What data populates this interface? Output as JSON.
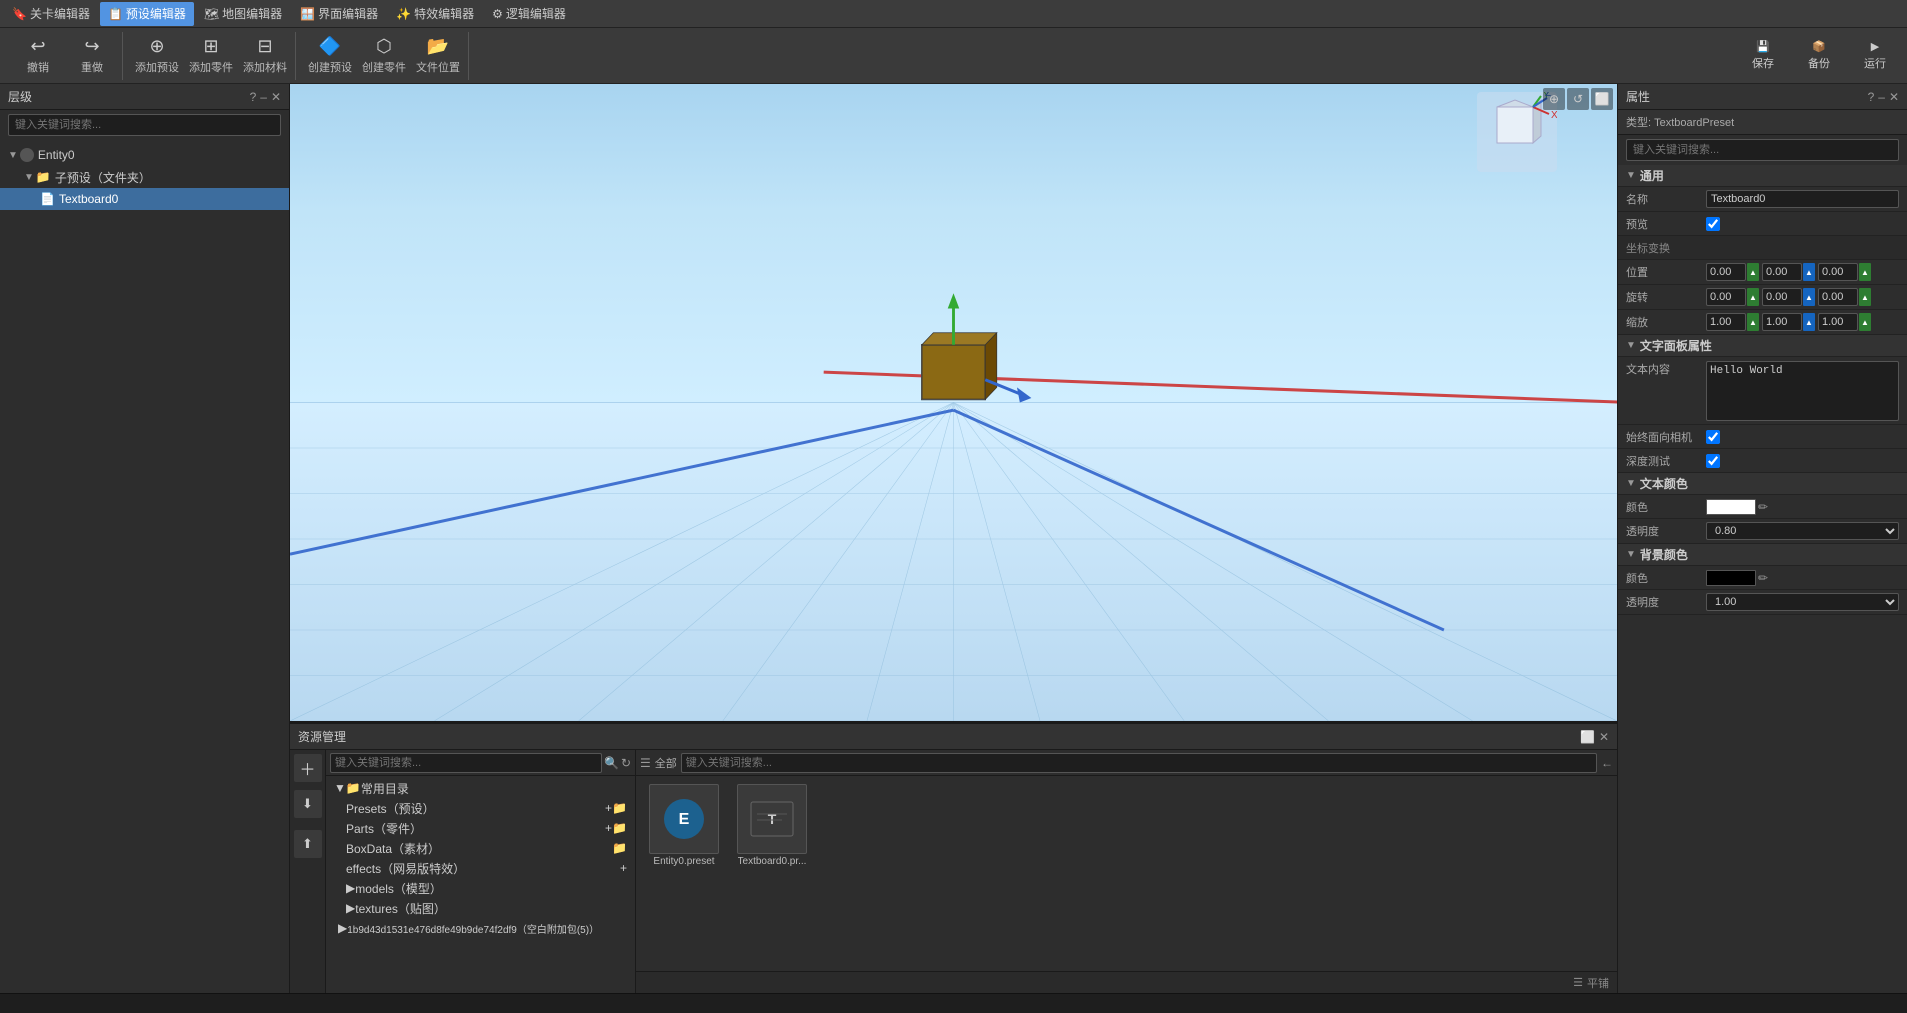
{
  "app": {
    "title": "预设编辑器"
  },
  "menu_tabs": [
    {
      "id": "bookmark",
      "label": "关卡编辑器",
      "icon": "🔖",
      "active": false
    },
    {
      "id": "preset",
      "label": "预设编辑器",
      "icon": "📋",
      "active": true
    },
    {
      "id": "map",
      "label": "地图编辑器",
      "icon": "🗺",
      "active": false
    },
    {
      "id": "ui",
      "label": "界面编辑器",
      "icon": "🪟",
      "active": false
    },
    {
      "id": "effect",
      "label": "特效编辑器",
      "icon": "✨",
      "active": false
    },
    {
      "id": "logic",
      "label": "逻辑编辑器",
      "icon": "⚙",
      "active": false
    }
  ],
  "toolbar": {
    "undo_label": "撤销",
    "redo_label": "重做",
    "add_preset_label": "添加预设",
    "add_part_label": "添加零件",
    "add_material_label": "添加材料",
    "create_preset_label": "创建预设",
    "create_part_label": "创建零件",
    "file_location_label": "文件位置",
    "save_label": "保存",
    "backup_label": "备份",
    "run_label": "运行"
  },
  "hierarchy": {
    "title": "层级",
    "search_placeholder": "键入关键词搜索...",
    "tree": [
      {
        "id": "entity0",
        "label": "Entity0",
        "icon": "○",
        "level": 0,
        "expanded": true
      },
      {
        "id": "sub_preset",
        "label": "子预设（文件夹）",
        "icon": "📁",
        "level": 1,
        "expanded": true
      },
      {
        "id": "textboard0",
        "label": "Textboard0",
        "icon": "📄",
        "level": 2,
        "selected": true
      }
    ]
  },
  "viewport": {
    "toolbar_icons": [
      "⊕",
      "↺",
      "⬜"
    ]
  },
  "asset_manager": {
    "title": "资源管理",
    "search_placeholder": "键入关键词搜索...",
    "tree_items": [
      {
        "label": "常用目录",
        "icon": "📁",
        "level": 0,
        "expanded": true
      },
      {
        "label": "Presets（预设）",
        "level": 1
      },
      {
        "label": "Parts（零件）",
        "level": 1
      },
      {
        "label": "BoxData（素材）",
        "level": 1
      },
      {
        "label": "effects（网易版特效）",
        "level": 1
      },
      {
        "label": "models（模型）",
        "level": 1,
        "has_arrow": true
      },
      {
        "label": "textures（贴图）",
        "level": 1,
        "has_arrow": true
      },
      {
        "label": "1b9d43d1531e476d8fe49b9de74f2df9（空白附加包(5)）",
        "level": 1,
        "has_arrow": true
      }
    ],
    "right_search_placeholder": "键入关键词搜索...",
    "filter_label": "全部",
    "assets": [
      {
        "name": "Entity0.preset",
        "icon": "🔵"
      },
      {
        "name": "Textboard0.pr...",
        "icon": "📋"
      }
    ],
    "footer_label": "平铺"
  },
  "properties": {
    "title": "属性",
    "type_label": "类型: TextboardPreset",
    "search_placeholder": "键入关键词搜索...",
    "sections": {
      "general": {
        "title": "通用",
        "name_label": "名称",
        "name_value": "Textboard0",
        "preview_label": "预览",
        "preview_checked": true,
        "transform_label": "坐标变换",
        "position_label": "位置",
        "position": {
          "x": "0.00",
          "y": "0.00",
          "z": "0.00"
        },
        "rotation_label": "旋转",
        "rotation": {
          "x": "0.00",
          "y": "0.00",
          "z": "0.00"
        },
        "scale_label": "缩放",
        "scale": {
          "x": "1.00",
          "y": "1.00",
          "z": "1.00"
        }
      },
      "textboard": {
        "title": "文字面板属性",
        "text_content_label": "文本内容",
        "text_content_value": "Hello World",
        "always_face_camera_label": "始终面向相机",
        "always_face_camera_checked": true,
        "depth_test_label": "深度测试",
        "depth_test_checked": true
      },
      "text_color": {
        "title": "文本颜色",
        "color_label": "颜色",
        "color_value": "#ffffff",
        "opacity_label": "透明度",
        "opacity_value": "0.80"
      },
      "bg_color": {
        "title": "背景颜色",
        "color_label": "颜色",
        "color_value": "#000000",
        "opacity_label": "透明度",
        "opacity_value": "1.00"
      }
    }
  }
}
